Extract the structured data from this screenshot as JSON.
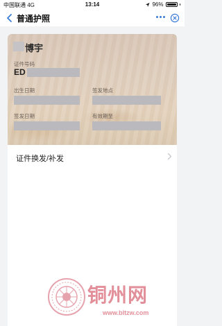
{
  "status_bar": {
    "carrier": "中国联通  4G",
    "time": "13:14",
    "battery": "96%"
  },
  "nav": {
    "title": "普通护照"
  },
  "card": {
    "name_suffix": "博宇",
    "number_label": "证件号码",
    "number_prefix": "ED",
    "birth_label": "出生日期",
    "issue_place_label": "签发地点",
    "issue_date_label": "签发日期",
    "expiry_label": "有效期至"
  },
  "actions": {
    "renew_label": "证件换发/补发"
  },
  "watermark": {
    "title": "铜州网",
    "url": "www.bltzw.com"
  },
  "colors": {
    "accent": "#3a7bd5",
    "watermark": "#e28f9a"
  }
}
